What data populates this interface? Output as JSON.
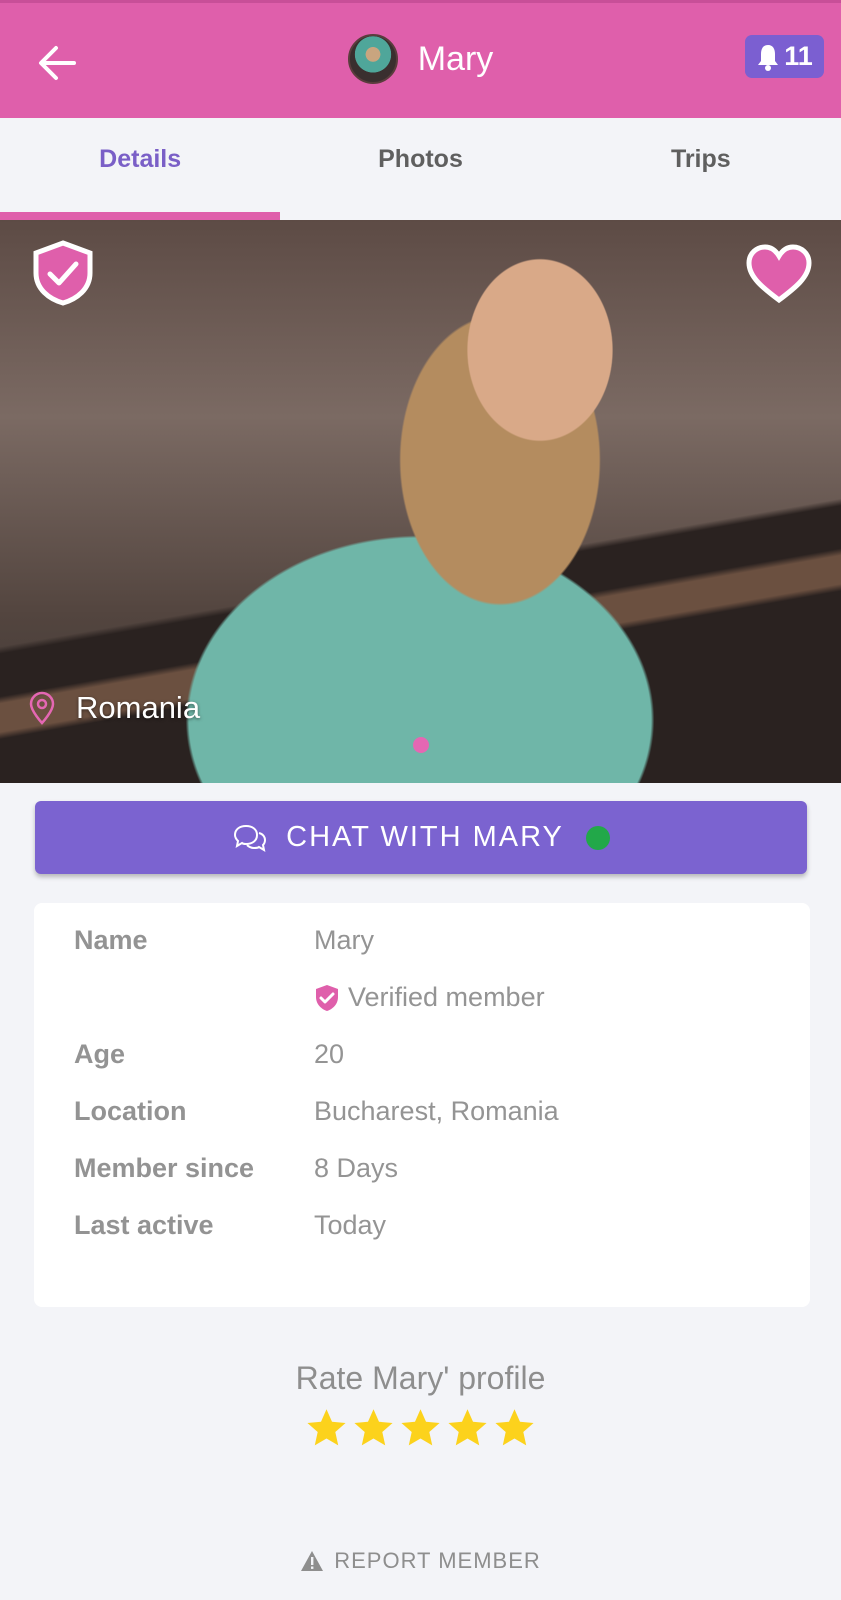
{
  "header": {
    "title": "Mary",
    "notification_count": "11"
  },
  "tabs": [
    {
      "label": "Details",
      "active": true
    },
    {
      "label": "Photos",
      "active": false
    },
    {
      "label": "Trips",
      "active": false
    }
  ],
  "hero": {
    "location": "Romania",
    "photo_index": 1,
    "photo_count": 1
  },
  "chat_button": {
    "label": "CHAT WITH MARY",
    "online": true
  },
  "details": {
    "rows": [
      {
        "label": "Name",
        "value": "Mary"
      },
      {
        "label": "",
        "value": "Verified member"
      },
      {
        "label": "Age",
        "value": "20"
      },
      {
        "label": "Location",
        "value": "Bucharest, Romania"
      },
      {
        "label": "Member since",
        "value": "8 Days"
      },
      {
        "label": "Last active",
        "value": "Today"
      }
    ]
  },
  "rating": {
    "prompt": "Rate Mary' profile",
    "stars": 5,
    "max_stars": 5
  },
  "report": {
    "label": "REPORT MEMBER"
  },
  "colors": {
    "brand_pink": "#df5fab",
    "brand_purple": "#7b63d0",
    "online_green": "#22a849",
    "star_yellow": "#fcd21c"
  }
}
